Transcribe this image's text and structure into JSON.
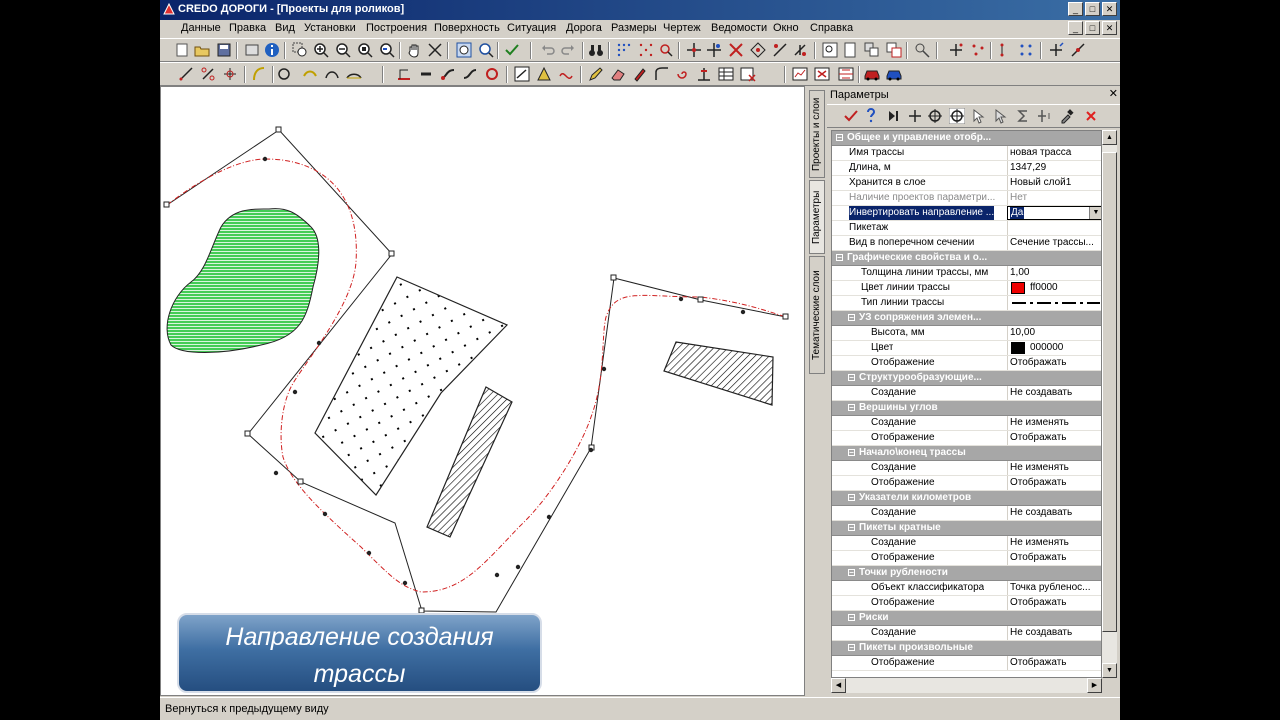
{
  "window": {
    "title": "CREDO ДОРОГИ - [Проекты для роликов]",
    "buttons": [
      "_",
      "□",
      "✕"
    ]
  },
  "menu": {
    "items": [
      "Данные",
      "Правка",
      "Вид",
      "Установки",
      "Построения",
      "Поверхность",
      "Ситуация",
      "Дорога",
      "Размеры",
      "Чертеж",
      "Ведомости",
      "Окно",
      "Справка"
    ]
  },
  "banner": {
    "line1": "Направление создания",
    "line2": "трассы"
  },
  "status": {
    "text": "Вернуться к предыдущему виду"
  },
  "panel": {
    "title": "Параметры",
    "close": "✕",
    "tabs": [
      "Проекты и слои",
      "Параметры",
      "Тематические слои"
    ],
    "rows": [
      {
        "type": "group",
        "level": 0,
        "name": "Общее и управление отобр..."
      },
      {
        "type": "prop",
        "level": 0,
        "name": "Имя трассы",
        "value": "новая трасса"
      },
      {
        "type": "prop",
        "level": 0,
        "name": "Длина, м",
        "value": "1347,29"
      },
      {
        "type": "prop",
        "level": 0,
        "name": "Хранится в слое",
        "value": "Новый слой1"
      },
      {
        "type": "prop",
        "level": 0,
        "name": "Наличие проектов параметри...",
        "value": "Нет",
        "disabled": true
      },
      {
        "type": "combo",
        "level": 0,
        "name": "Инвертировать направление ...",
        "value": "Да"
      },
      {
        "type": "prop",
        "level": 0,
        "name": "Пикетаж",
        "value": ""
      },
      {
        "type": "prop",
        "level": 0,
        "name": "Вид в поперечном сечении",
        "value": "Сечение трассы..."
      },
      {
        "type": "group",
        "level": 0,
        "name": "Графические свойства и о..."
      },
      {
        "type": "prop",
        "level": 1,
        "name": "Толщина линии трассы, мм",
        "value": "1,00"
      },
      {
        "type": "color",
        "level": 1,
        "name": "Цвет линии трассы",
        "value": "ff0000",
        "color": "#ee0000"
      },
      {
        "type": "line",
        "level": 1,
        "name": "Тип линии трассы",
        "value": ""
      },
      {
        "type": "group",
        "level": 1,
        "name": "УЗ сопряжения элемен..."
      },
      {
        "type": "prop",
        "level": 2,
        "name": "Высота, мм",
        "value": "10,00"
      },
      {
        "type": "color",
        "level": 2,
        "name": "Цвет",
        "value": "000000",
        "color": "#000000"
      },
      {
        "type": "prop",
        "level": 2,
        "name": "Отображение",
        "value": "Отображать"
      },
      {
        "type": "group",
        "level": 1,
        "name": "Структурообразующие..."
      },
      {
        "type": "prop",
        "level": 2,
        "name": "Создание",
        "value": "Не создавать"
      },
      {
        "type": "group",
        "level": 1,
        "name": "Вершины углов"
      },
      {
        "type": "prop",
        "level": 2,
        "name": "Создание",
        "value": "Не изменять"
      },
      {
        "type": "prop",
        "level": 2,
        "name": "Отображение",
        "value": "Отображать"
      },
      {
        "type": "group",
        "level": 1,
        "name": "Начало\\конец трассы"
      },
      {
        "type": "prop",
        "level": 2,
        "name": "Создание",
        "value": "Не изменять"
      },
      {
        "type": "prop",
        "level": 2,
        "name": "Отображение",
        "value": "Отображать"
      },
      {
        "type": "group",
        "level": 1,
        "name": "Указатели километров"
      },
      {
        "type": "prop",
        "level": 2,
        "name": "Создание",
        "value": "Не создавать"
      },
      {
        "type": "group",
        "level": 1,
        "name": "Пикеты кратные"
      },
      {
        "type": "prop",
        "level": 2,
        "name": "Создание",
        "value": "Не изменять"
      },
      {
        "type": "prop",
        "level": 2,
        "name": "Отображение",
        "value": "Отображать"
      },
      {
        "type": "group",
        "level": 1,
        "name": "Точки рублености"
      },
      {
        "type": "prop",
        "level": 2,
        "name": "Объект классификатора",
        "value": "Точка рубленос..."
      },
      {
        "type": "prop",
        "level": 2,
        "name": "Отображение",
        "value": "Отображать"
      },
      {
        "type": "group",
        "level": 1,
        "name": "Риски"
      },
      {
        "type": "prop",
        "level": 2,
        "name": "Создание",
        "value": "Не создавать"
      },
      {
        "type": "group",
        "level": 1,
        "name": "Пикеты произвольные"
      },
      {
        "type": "prop",
        "level": 2,
        "name": "Отображение",
        "value": "Отображать"
      }
    ]
  },
  "colors": {
    "route": "#d02020",
    "titlebar": "#0a246a",
    "polygon": "#44cc55"
  }
}
